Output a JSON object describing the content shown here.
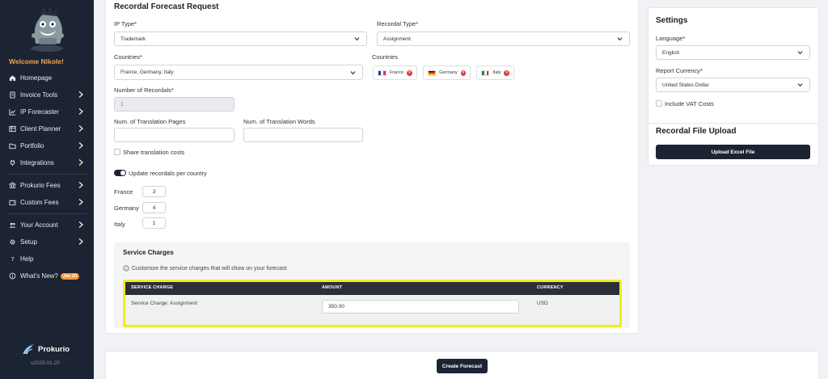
{
  "sidebar": {
    "welcome": "Welcome Nikole!",
    "items": [
      {
        "label": "Homepage",
        "icon": "home-icon",
        "chevron": false
      },
      {
        "label": "Invoice Tools",
        "icon": "invoice-icon",
        "chevron": true
      },
      {
        "label": "IP Forecaster",
        "icon": "chart-icon",
        "chevron": true
      },
      {
        "label": "Client Planner",
        "icon": "table-icon",
        "chevron": true
      },
      {
        "label": "Portfolio",
        "icon": "folder-icon",
        "chevron": true
      },
      {
        "label": "Integrations",
        "icon": "plug-icon",
        "chevron": true
      },
      {
        "label": "Prokurio Fees",
        "icon": "bank-icon",
        "chevron": true
      },
      {
        "label": "Custom Fees",
        "icon": "wallet-icon",
        "chevron": true
      },
      {
        "label": "Your Account",
        "icon": "users-icon",
        "chevron": true
      },
      {
        "label": "Setup",
        "icon": "gear-icon",
        "chevron": true
      },
      {
        "label": "Help",
        "icon": "question-icon",
        "chevron": false
      },
      {
        "label": "What's New?",
        "icon": "info-icon",
        "chevron": false,
        "badge": "Jan 20"
      }
    ],
    "brand": "Prokurio",
    "version": "v2025.01.20"
  },
  "form": {
    "title": "Recordal Forecast Request",
    "ip_type_label": "IP Type*",
    "ip_type_value": "Trademark",
    "recordal_type_label": "Recordal Type*",
    "recordal_type_value": "Assignment",
    "countries_label": "Countries*",
    "countries_value": "France, Germany, Italy",
    "countries_chips_label": "Countries",
    "chips": [
      "France",
      "Germany",
      "Italy"
    ],
    "num_recordals_label": "Number of Recordals*",
    "num_recordals_value": "1",
    "translation_pages_label": "Num. of Translation Pages",
    "translation_words_label": "Num. of Translation Words",
    "share_costs_label": "Share translation costs",
    "update_per_country_label": "Update recordals per country",
    "per_country": [
      {
        "country": "France",
        "value": "3"
      },
      {
        "country": "Germany",
        "value": "4"
      },
      {
        "country": "Italy",
        "value": "1"
      }
    ]
  },
  "service_charges": {
    "title": "Service Charges",
    "hint": "Customize the service charges that will show on your forecast",
    "columns": [
      "SERVICE CHARGE",
      "AMOUNT",
      "CURRENCY"
    ],
    "row": {
      "name": "Service Charge: Assignment",
      "amount": "350.00",
      "currency": "USD"
    }
  },
  "settings": {
    "title": "Settings",
    "language_label": "Language*",
    "language_value": "English",
    "currency_label": "Report Currency*",
    "currency_value": "United States Dollar",
    "vat_label": "Include VAT Costs",
    "upload_title": "Recordal File Upload",
    "upload_button": "Upload Excel File"
  },
  "footer": {
    "create_button": "Create Forecast"
  },
  "colors": {
    "sidebar_bg": "#1c2433",
    "accent_orange": "#f3a64a",
    "highlight_yellow": "#f2ec1f",
    "remove_red": "#e03a3a"
  }
}
